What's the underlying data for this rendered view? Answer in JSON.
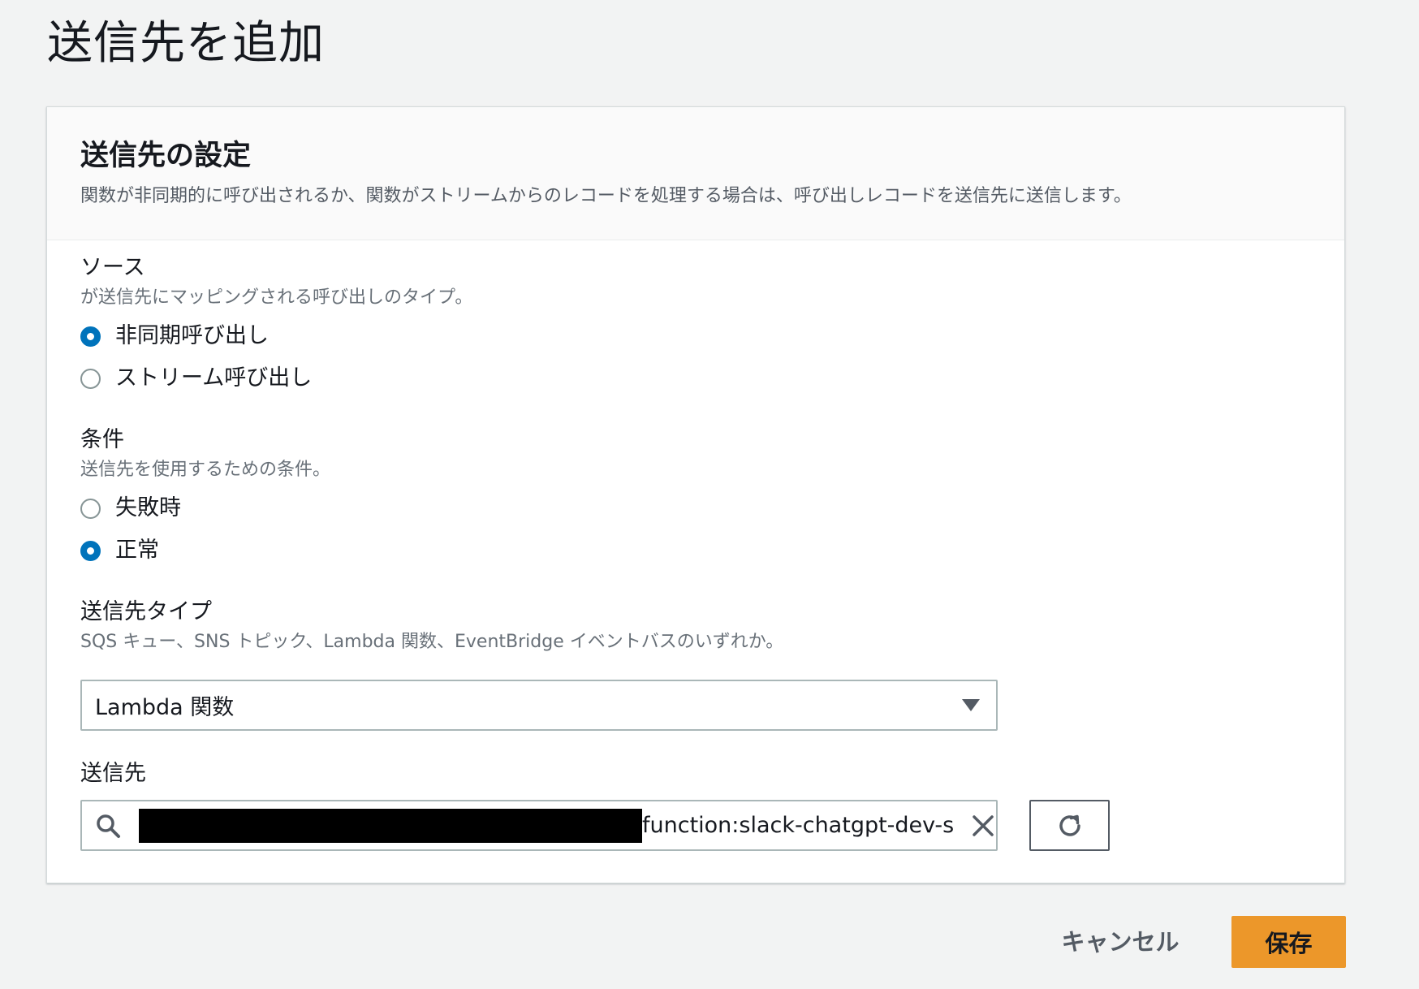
{
  "page": {
    "title": "送信先を追加"
  },
  "panel": {
    "title": "送信先の設定",
    "description": "関数が非同期的に呼び出されるか、関数がストリームからのレコードを処理する場合は、呼び出しレコードを送信先に送信します。"
  },
  "source": {
    "label": "ソース",
    "description": "が送信先にマッピングされる呼び出しのタイプ。",
    "options": [
      {
        "label": "非同期呼び出し",
        "checked": true
      },
      {
        "label": "ストリーム呼び出し",
        "checked": false
      }
    ]
  },
  "condition": {
    "label": "条件",
    "description": "送信先を使用するための条件。",
    "options": [
      {
        "label": "失敗時",
        "checked": false
      },
      {
        "label": "正常",
        "checked": true
      }
    ]
  },
  "destination_type": {
    "label": "送信先タイプ",
    "description": "SQS キュー、SNS トピック、Lambda 関数、EventBridge イベントバスのいずれか。",
    "selected": "Lambda 関数"
  },
  "destination": {
    "label": "送信先",
    "value": "function:slack-chatgpt-dev-sla"
  },
  "footer": {
    "cancel_label": "キャンセル",
    "save_label": "保存"
  },
  "colors": {
    "accent_blue": "#0073bb",
    "primary_orange": "#ec972a",
    "background": "#f2f3f3"
  }
}
